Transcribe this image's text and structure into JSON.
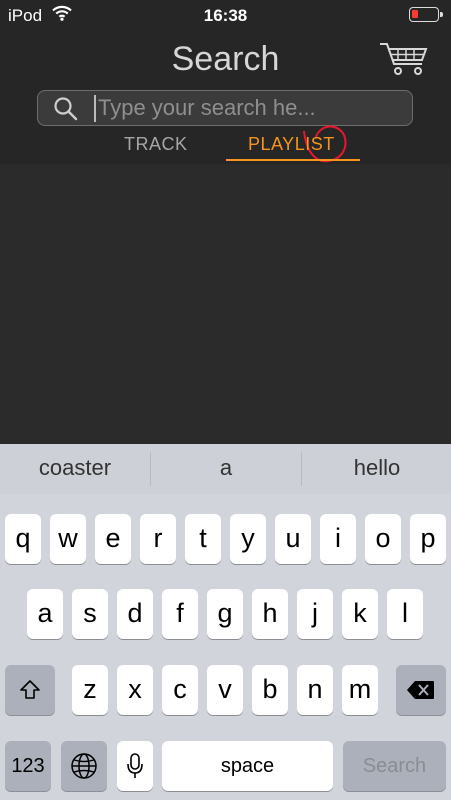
{
  "status": {
    "carrier": "iPod",
    "time": "16:38",
    "battery_color": "#ff3b30"
  },
  "header": {
    "title": "Search",
    "cart_icon": "cart-icon"
  },
  "search": {
    "placeholder": "Type your search he...",
    "icon": "search-icon"
  },
  "tabs": [
    {
      "label": "TRACK",
      "active": false
    },
    {
      "label": "PLAYLIST",
      "active": true
    }
  ],
  "accent_color": "#f7941d",
  "keyboard": {
    "suggestions": [
      "coaster",
      "a",
      "hello"
    ],
    "row1": [
      "q",
      "w",
      "e",
      "r",
      "t",
      "y",
      "u",
      "i",
      "o",
      "p"
    ],
    "row2": [
      "a",
      "s",
      "d",
      "f",
      "g",
      "h",
      "j",
      "k",
      "l"
    ],
    "row3": [
      "z",
      "x",
      "c",
      "v",
      "b",
      "n",
      "m"
    ],
    "numbers_label": "123",
    "space_label": "space",
    "search_label": "Search"
  }
}
